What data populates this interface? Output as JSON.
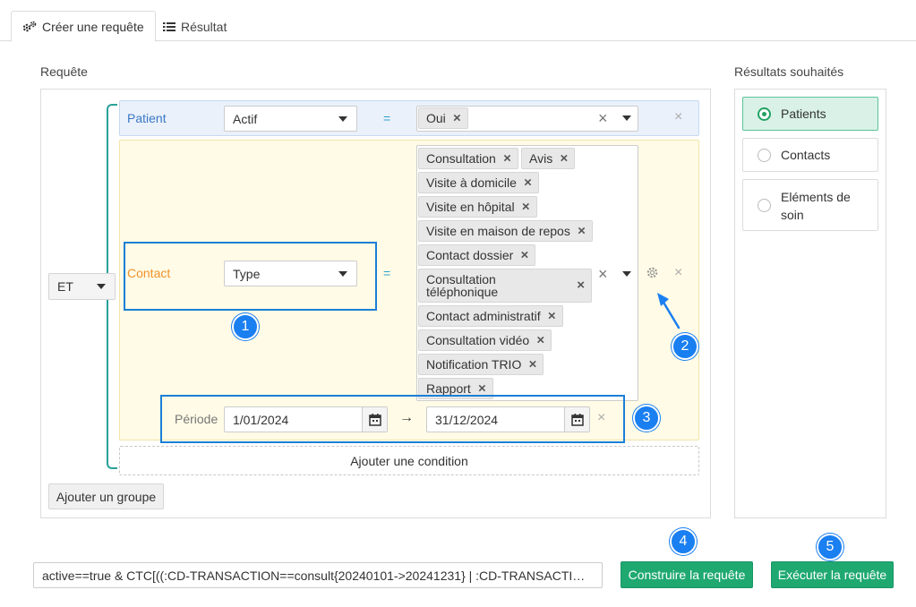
{
  "tabs": [
    {
      "label": "Créer une requête",
      "icon": "gears-icon",
      "active": true
    },
    {
      "label": "Résultat",
      "icon": "list-icon",
      "active": false
    }
  ],
  "sections": {
    "query_label": "Requête",
    "results_label": "Résultats souhaités"
  },
  "group": {
    "operator": "ET"
  },
  "conditions": {
    "patient": {
      "entity": "Patient",
      "field": "Actif",
      "operator": "=",
      "values": [
        "Oui"
      ]
    },
    "contact": {
      "entity": "Contact",
      "field": "Type",
      "operator": "=",
      "values": [
        "Consultation",
        "Avis",
        "Visite à domicile",
        "Visite en hôpital",
        "Visite en maison de repos",
        "Contact dossier",
        "Consultation téléphonique",
        "Contact administratif",
        "Consultation vidéo",
        "Notification TRIO",
        "Rapport"
      ],
      "period": {
        "label": "Période",
        "from": "1/01/2024",
        "arrow": "→",
        "to": "31/12/2024"
      }
    }
  },
  "buttons": {
    "add_condition": "Ajouter une condition",
    "add_group": "Ajouter un groupe",
    "build_query": "Construire la requête",
    "run_query": "Exécuter la requête"
  },
  "results_options": [
    {
      "label": "Patients",
      "selected": true
    },
    {
      "label": "Contacts",
      "selected": false
    },
    {
      "label": "Eléments de soin",
      "selected": false
    }
  ],
  "query_string": "active==true & CTC[((:CD-TRANSACTION==consult{20240101->20241231} | :CD-TRANSACTION==...",
  "annotations": [
    "1",
    "2",
    "3",
    "4",
    "5"
  ],
  "colors": {
    "accent_green": "#1fa971",
    "annotation_blue": "#1a7ff0",
    "patient_row_bg": "#eaf1fb",
    "contact_row_bg": "#fffbe6",
    "contact_label": "#f0922b",
    "patient_label": "#3b78c4"
  }
}
